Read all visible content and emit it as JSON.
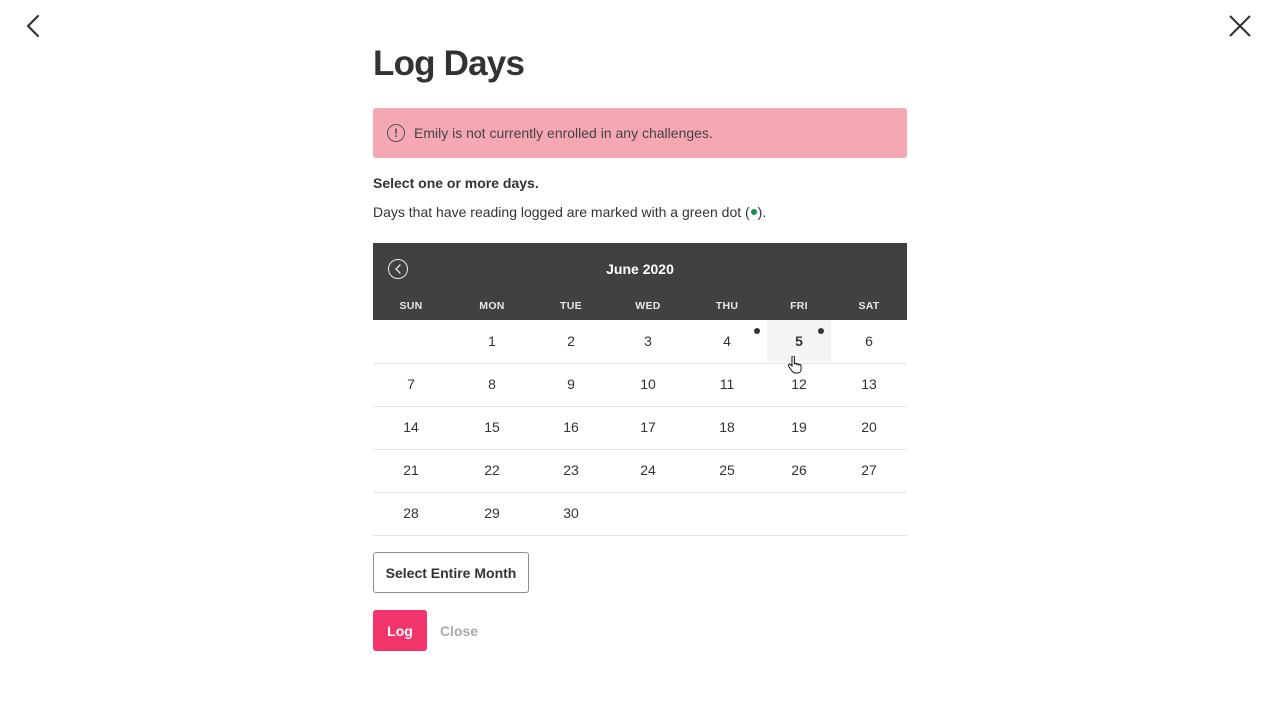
{
  "icons": {
    "back": "chevron-left-icon",
    "close": "close-icon",
    "alert": "exclamation-circle-icon",
    "calendar_prev": "chevron-left-circle-icon"
  },
  "colors": {
    "alert_bg": "#f6a7b4",
    "calendar_header_bg": "#414141",
    "log_button_bg": "#f2366d",
    "logged_dot": "#1a8f4a"
  },
  "page": {
    "title": "Log Days"
  },
  "alert": {
    "icon_glyph": "!",
    "text": "Emily is not currently enrolled in any challenges."
  },
  "instructions": {
    "select": "Select one or more days.",
    "hint_before": "Days that have reading logged are marked with a green dot (",
    "hint_after": ")."
  },
  "calendar": {
    "month": "June 2020",
    "days_of_week": [
      "SUN",
      "MON",
      "TUE",
      "WED",
      "THU",
      "FRI",
      "SAT"
    ],
    "weeks": [
      [
        "",
        "1",
        "2",
        "3",
        "4",
        "5",
        "6"
      ],
      [
        "7",
        "8",
        "9",
        "10",
        "11",
        "12",
        "13"
      ],
      [
        "14",
        "15",
        "16",
        "17",
        "18",
        "19",
        "20"
      ],
      [
        "21",
        "22",
        "23",
        "24",
        "25",
        "26",
        "27"
      ],
      [
        "28",
        "29",
        "30",
        "",
        "",
        "",
        ""
      ]
    ],
    "hovered_day": "5"
  },
  "buttons": {
    "select_month": "Select Entire Month",
    "log": "Log",
    "close": "Close"
  }
}
